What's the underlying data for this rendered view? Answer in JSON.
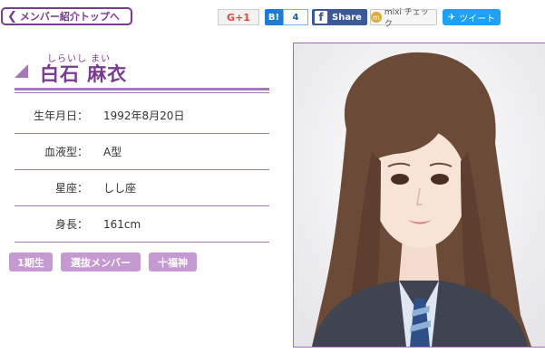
{
  "nav": {
    "back_label": "メンバー紹介トップへ",
    "back_icon": "chevron-left-icon"
  },
  "share": {
    "gplus_label": "G+1",
    "hatena_label": "B!",
    "hatena_count": "4",
    "facebook_label": "Share",
    "mixi_label": "mixi チェック",
    "twitter_label": "ツイート"
  },
  "member": {
    "furigana": "しらいし まい",
    "name": "白石 麻衣"
  },
  "profile": [
    {
      "label": "生年月日：",
      "value": "1992年8月20日"
    },
    {
      "label": "血液型：",
      "value": "A型"
    },
    {
      "label": "星座：",
      "value": "しし座"
    },
    {
      "label": "身長：",
      "value": "161cm"
    }
  ],
  "tags": [
    "1期生",
    "選抜メンバー",
    "十福神"
  ],
  "colors": {
    "accent": "#7b3a91",
    "accent_light": "#a678b8",
    "tag_bg": "#c59ad2"
  }
}
